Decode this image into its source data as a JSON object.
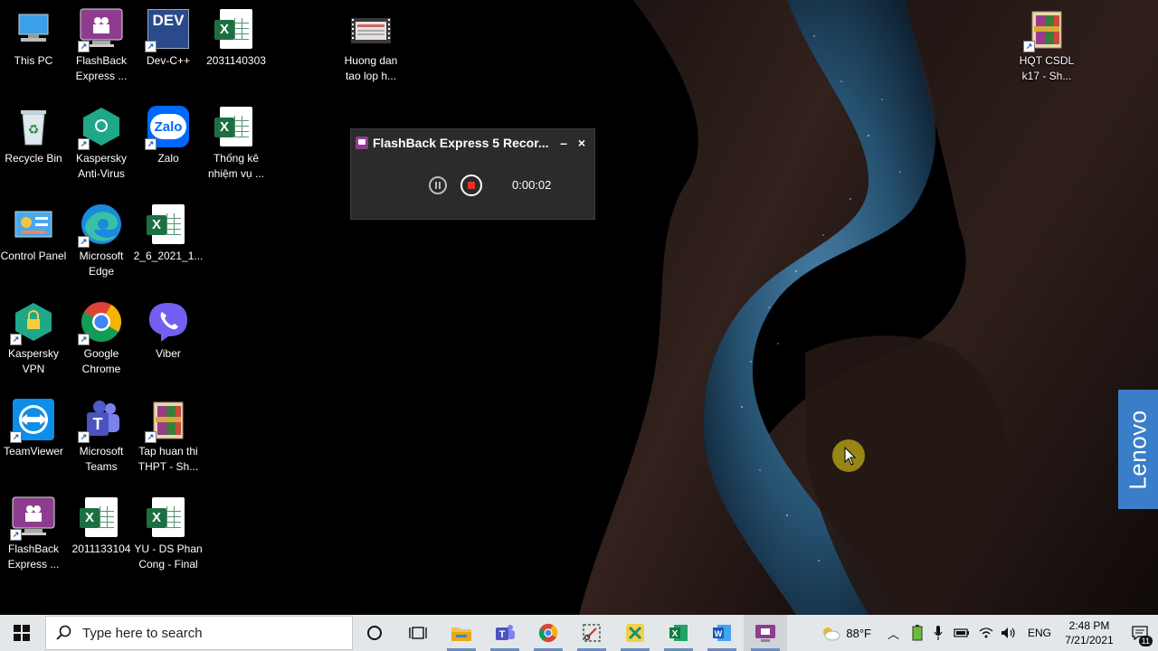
{
  "desktop": {
    "icons": [
      {
        "label": "This PC"
      },
      {
        "label": "FlashBack\nExpress ..."
      },
      {
        "label": "Dev-C++"
      },
      {
        "label": "2031140303"
      },
      {
        "label": "Recycle Bin"
      },
      {
        "label": "Kaspersky\nAnti-Virus"
      },
      {
        "label": "Zalo"
      },
      {
        "label": "Thống kê\nnhiệm vụ ..."
      },
      {
        "label": "Control Panel"
      },
      {
        "label": "Microsoft\nEdge"
      },
      {
        "label": "2_6_2021_1..."
      },
      {
        "label": "Kaspersky\nVPN"
      },
      {
        "label": "Google\nChrome"
      },
      {
        "label": "Viber"
      },
      {
        "label": "TeamViewer"
      },
      {
        "label": "Microsoft\nTeams"
      },
      {
        "label": "Tap huan thi\nTHPT - Sh..."
      },
      {
        "label": "FlashBack\nExpress ..."
      },
      {
        "label": "2011133104"
      },
      {
        "label": "YU - DS Phan\nCong - Final"
      },
      {
        "label": "Huong dan\ntao lop h..."
      },
      {
        "label": "HQT CSDL\nk17 - Sh..."
      }
    ],
    "icon_texts": {
      "devcpp": "DEV",
      "zalo": "Zalo",
      "excel": "X"
    }
  },
  "recorder": {
    "title": "FlashBack Express 5 Recor...",
    "minimize": "–",
    "close": "×",
    "elapsed": "0:00:02"
  },
  "brand": {
    "lenovo": "Lenovo"
  },
  "taskbar": {
    "search_placeholder": "Type here to search",
    "apps": [
      "cortana-icon",
      "task-view-icon",
      "file-explorer-icon",
      "teams-icon",
      "chrome-icon",
      "snipping-tool-icon",
      "xmind-icon",
      "excel-icon",
      "word-icon",
      "flashback-icon"
    ],
    "weather": "88°F",
    "language": "ENG",
    "time": "2:48 PM",
    "date": "7/21/2021",
    "notifications": "11"
  },
  "colors": {
    "accent": "#3a7dc9",
    "taskbar": "#e4e7ea",
    "record": "#e5322d"
  }
}
